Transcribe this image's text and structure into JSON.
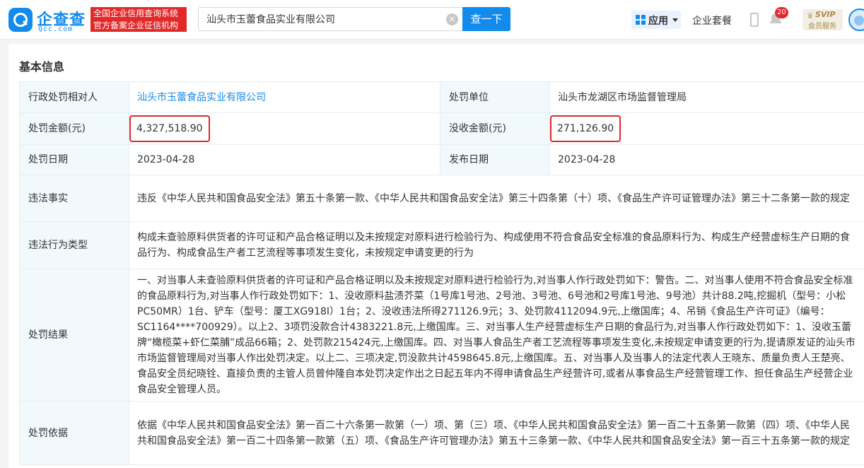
{
  "header": {
    "logo_text": "企查查",
    "logo_sub": "Qcc.com",
    "slogan_line1": "全国企业信用查询系统",
    "slogan_line2": "官方备案企业征信机构",
    "search_value": "汕头市玉蕾食品实业有限公司",
    "search_button": "查一下",
    "apps_label": "应用",
    "suite_label": "企业套餐",
    "notification_count": "20",
    "svip_title": "SVIP",
    "svip_sub": "会员服务",
    "brand_color": "#128bed"
  },
  "section_title": "基本信息",
  "rows": {
    "party_label": "行政处罚相对人",
    "party_value": "汕头市玉蕾食品实业有限公司",
    "unit_label": "处罚单位",
    "unit_value": "汕头市龙湖区市场监督管理局",
    "fine_label": "处罚金额(元)",
    "fine_value": "4,327,518.90",
    "confiscate_label": "没收金额(元)",
    "confiscate_value": "271,126.90",
    "date_label": "处罚日期",
    "date_value": "2023-04-28",
    "publish_label": "发布日期",
    "publish_value": "2023-04-28",
    "facts_label": "违法事实",
    "facts_value": "违反《中华人民共和国食品安全法》第五十条第一款、《中华人民共和国食品安全法》第三十四条第（十）项、《食品生产许可证管理办法》第三十二条第一款的规定",
    "type_label": "违法行为类型",
    "type_value": "构成未查验原料供货者的许可证和产品合格证明以及未按规定对原料进行检验行为、构成使用不符合食品安全标准的食品原料行为、构成生产经营虚标生产日期的食品行为、构成食品生产者工艺流程等事项发生变化，未按规定申请变更的行为",
    "result_label": "处罚结果",
    "result_value": "一、对当事人未查验原料供货者的许可证和产品合格证明以及未按规定对原料进行检验行为,对当事人作行政处罚如下：警告。二、对当事人使用不符合食品安全标准的食品原料行为,对当事人作行政处罚如下：1、没收原料盐渍芥菜（1号库1号池、2号池、3号池、6号池和2号库1号池、9号池）共计88.2吨,挖掘机（型号：小松PC50MR）1台、铲车（型号：厦工XG918I）1台；2、没收违法所得271126.9元；3、处罚款4112094.9元,上缴国库；4、吊销《食品生产许可证》（编号：SC1164****700929）。以上2、3项罚没款合计4383221.8元,上缴国库。三、对当事人生产经营虚标生产日期的食品行为,对当事人作行政处罚如下：1、没收玉蕾牌“橄榄菜+虾仁菜脯”成品66箱；2、处罚款215424元,上缴国库。四、对当事人食品生产者工艺流程等事项发生变化,未按规定申请变更的行为,提请原发证的汕头市市场监督管理局对当事人作出处罚决定。以上二、三项决定,罚没款共计4598645.8元,上缴国库。五、对当事人及当事人的法定代表人王晓东、质量负责人王楚亮、食品安全员纪晓铨、直接负责的主管人员曾仲隆自本处罚决定作出之日起五年内不得申请食品生产经营许可,或者从事食品生产经营管理工作、担任食品生产经营企业食品安全管理人员。",
    "basis_label": "处罚依据",
    "basis_value": "依据《中华人民共和国食品安全法》第一百二十六条第一款第（一）项、第（三）项、《中华人民共和国食品安全法》第一百二十五条第一款第（四）项、《中华人民共和国食品安全法》第一百二十四条第一款第（五）项、《食品生产许可管理办法》第五十三条第一款、《中华人民共和国食品安全法》第一百三十五条第一款的规定"
  }
}
